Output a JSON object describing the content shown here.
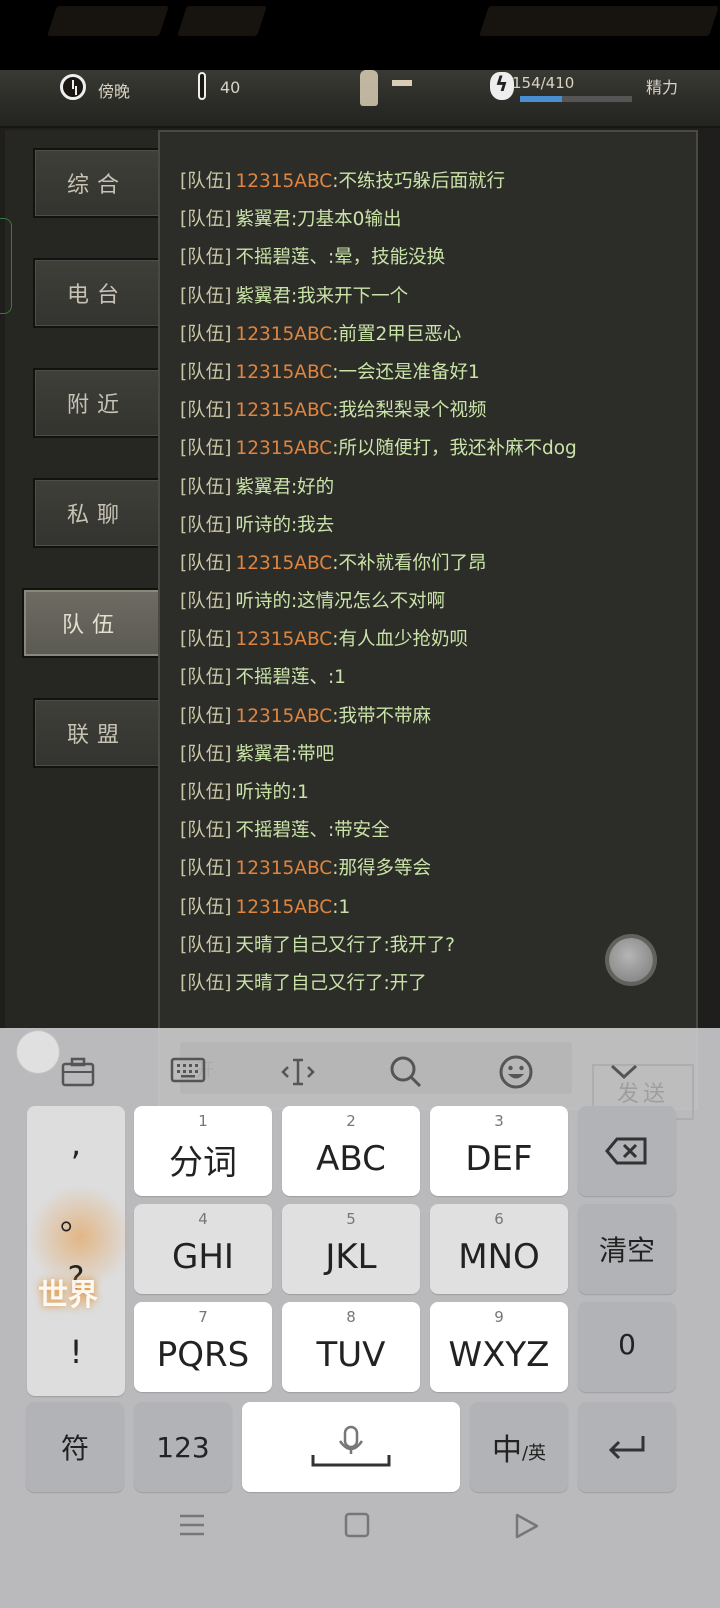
{
  "hud": {
    "time_label": "傍晚",
    "temperature": "40",
    "energy_text": "154/410",
    "energy_label": "精力",
    "energy_fraction": 0.376
  },
  "tabs": [
    {
      "label": "综合",
      "active": false
    },
    {
      "label": "电台",
      "active": false
    },
    {
      "label": "附近",
      "active": false
    },
    {
      "label": "私聊",
      "active": false
    },
    {
      "label": "队伍",
      "active": true
    },
    {
      "label": "联盟",
      "active": false
    }
  ],
  "chat": {
    "channel_prefix": "[队伍]",
    "messages": [
      {
        "name": "12315ABC",
        "color": "orange",
        "text": ":不练技巧躲后面就行"
      },
      {
        "name": "紫翼君",
        "color": "green",
        "text": ":刀基本0输出"
      },
      {
        "name": "不摇碧莲、",
        "color": "green",
        "text": ":晕，技能没换"
      },
      {
        "name": "紫翼君",
        "color": "green",
        "text": ":我来开下一个"
      },
      {
        "name": "12315ABC",
        "color": "orange",
        "text": ":前置2甲巨恶心"
      },
      {
        "name": "12315ABC",
        "color": "orange",
        "text": ":一会还是准备好1"
      },
      {
        "name": "12315ABC",
        "color": "orange",
        "text": ":我给梨梨录个视频"
      },
      {
        "name": "12315ABC",
        "color": "orange",
        "text": ":所以随便打，我还补麻不dog"
      },
      {
        "name": "紫翼君",
        "color": "green",
        "text": ":好的"
      },
      {
        "name": "听诗的",
        "color": "green",
        "text": ":我去"
      },
      {
        "name": "12315ABC",
        "color": "orange",
        "text": ":不补就看你们了昂"
      },
      {
        "name": "听诗的",
        "color": "green",
        "text": ":这情况怎么不对啊"
      },
      {
        "name": "12315ABC",
        "color": "orange",
        "text": ":有人血少抢奶呗"
      },
      {
        "name": "不摇碧莲、",
        "color": "green",
        "text": ":1"
      },
      {
        "name": "12315ABC",
        "color": "orange",
        "text": ":我带不带麻"
      },
      {
        "name": "紫翼君",
        "color": "green",
        "text": ":带吧"
      },
      {
        "name": "听诗的",
        "color": "green",
        "text": ":1"
      },
      {
        "name": "不摇碧莲、",
        "color": "green",
        "text": ":带安全"
      },
      {
        "name": "12315ABC",
        "color": "orange",
        "text": ":那得多等会"
      },
      {
        "name": "12315ABC",
        "color": "orange",
        "text": ":1"
      },
      {
        "name": "天晴了自己又行了",
        "color": "green",
        "text": ":我开了?"
      },
      {
        "name": "天晴了自己又行了",
        "color": "green",
        "text": ":开了"
      }
    ],
    "input_ghost_text": "开",
    "send_label": "发送"
  },
  "world_label": "世界",
  "keyboard": {
    "punct": [
      ",",
      "。",
      "?",
      "!"
    ],
    "row1": [
      {
        "num": "1",
        "label": "分词"
      },
      {
        "num": "2",
        "label": "ABC"
      },
      {
        "num": "3",
        "label": "DEF"
      }
    ],
    "row2": [
      {
        "num": "4",
        "label": "GHI"
      },
      {
        "num": "5",
        "label": "JKL"
      },
      {
        "num": "6",
        "label": "MNO"
      }
    ],
    "row3": [
      {
        "num": "7",
        "label": "PQRS"
      },
      {
        "num": "8",
        "label": "TUV"
      },
      {
        "num": "9",
        "label": "WXYZ"
      }
    ],
    "clear_label": "清空",
    "zero_label": "0",
    "symbol_label": "符",
    "num_label": "123",
    "lang_main": "中",
    "lang_sub": "/英"
  }
}
